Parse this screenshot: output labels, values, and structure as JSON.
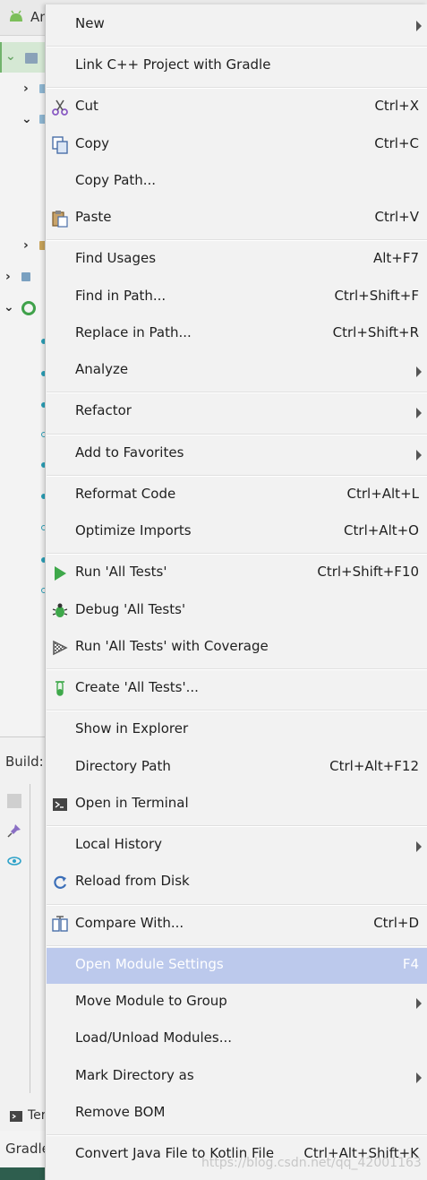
{
  "ide": {
    "project_title": "An",
    "build_label": "Build:",
    "terminal_label": "Ter",
    "gradle_label": "Gradle"
  },
  "menu": {
    "items": [
      {
        "label": "New",
        "shortcut": "",
        "submenu": true,
        "icon": ""
      },
      {
        "label": "Link C++ Project with Gradle",
        "shortcut": "",
        "submenu": false,
        "icon": ""
      },
      {
        "label": "Cut",
        "shortcut": "Ctrl+X",
        "submenu": false,
        "icon": "scissors-icon"
      },
      {
        "label": "Copy",
        "shortcut": "Ctrl+C",
        "submenu": false,
        "icon": "copy-icon"
      },
      {
        "label": "Copy Path...",
        "shortcut": "",
        "submenu": false,
        "icon": ""
      },
      {
        "label": "Paste",
        "shortcut": "Ctrl+V",
        "submenu": false,
        "icon": "paste-icon"
      },
      {
        "label": "Find Usages",
        "shortcut": "Alt+F7",
        "submenu": false,
        "icon": ""
      },
      {
        "label": "Find in Path...",
        "shortcut": "Ctrl+Shift+F",
        "submenu": false,
        "icon": ""
      },
      {
        "label": "Replace in Path...",
        "shortcut": "Ctrl+Shift+R",
        "submenu": false,
        "icon": ""
      },
      {
        "label": "Analyze",
        "shortcut": "",
        "submenu": true,
        "icon": ""
      },
      {
        "label": "Refactor",
        "shortcut": "",
        "submenu": true,
        "icon": ""
      },
      {
        "label": "Add to Favorites",
        "shortcut": "",
        "submenu": true,
        "icon": ""
      },
      {
        "label": "Reformat Code",
        "shortcut": "Ctrl+Alt+L",
        "submenu": false,
        "icon": ""
      },
      {
        "label": "Optimize Imports",
        "shortcut": "Ctrl+Alt+O",
        "submenu": false,
        "icon": ""
      },
      {
        "label": "Run 'All Tests'",
        "shortcut": "Ctrl+Shift+F10",
        "submenu": false,
        "icon": "run-icon"
      },
      {
        "label": "Debug 'All Tests'",
        "shortcut": "",
        "submenu": false,
        "icon": "debug-bug-icon"
      },
      {
        "label": "Run 'All Tests' with Coverage",
        "shortcut": "",
        "submenu": false,
        "icon": "coverage-icon"
      },
      {
        "label": "Create 'All Tests'...",
        "shortcut": "",
        "submenu": false,
        "icon": "test-tube-icon"
      },
      {
        "label": "Show in Explorer",
        "shortcut": "",
        "submenu": false,
        "icon": ""
      },
      {
        "label": "Directory Path",
        "shortcut": "Ctrl+Alt+F12",
        "submenu": false,
        "icon": ""
      },
      {
        "label": "Open in Terminal",
        "shortcut": "",
        "submenu": false,
        "icon": "terminal-icon"
      },
      {
        "label": "Local History",
        "shortcut": "",
        "submenu": true,
        "icon": ""
      },
      {
        "label": "Reload from Disk",
        "shortcut": "",
        "submenu": false,
        "icon": "reload-icon"
      },
      {
        "label": "Compare With...",
        "shortcut": "Ctrl+D",
        "submenu": false,
        "icon": "compare-icon"
      },
      {
        "label": "Open Module Settings",
        "shortcut": "F4",
        "submenu": false,
        "icon": "",
        "highlighted": true
      },
      {
        "label": "Move Module to Group",
        "shortcut": "",
        "submenu": true,
        "icon": ""
      },
      {
        "label": "Load/Unload Modules...",
        "shortcut": "",
        "submenu": false,
        "icon": ""
      },
      {
        "label": "Mark Directory as",
        "shortcut": "",
        "submenu": true,
        "icon": ""
      },
      {
        "label": "Remove BOM",
        "shortcut": "",
        "submenu": false,
        "icon": ""
      },
      {
        "label": "Convert Java File to Kotlin File",
        "shortcut": "Ctrl+Alt+Shift+K",
        "submenu": false,
        "icon": ""
      }
    ]
  },
  "watermark": "https://blog.csdn.net/qq_42001163",
  "colors": {
    "highlight": "#bcc9ec",
    "run_green": "#3ea84a",
    "menu_bg": "#f2f2f2"
  }
}
